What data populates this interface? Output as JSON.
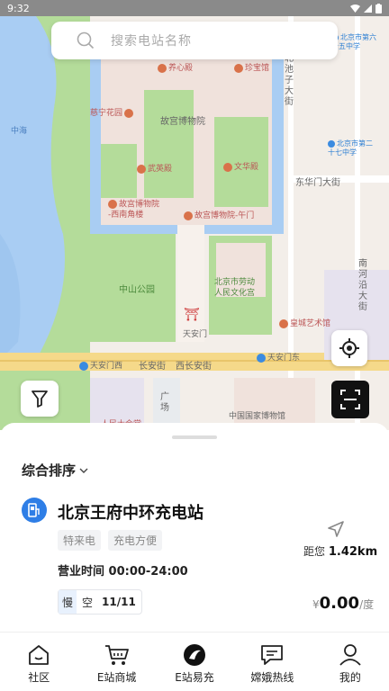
{
  "status": {
    "time": "9:32"
  },
  "search": {
    "placeholder": "搜索电站名称"
  },
  "map": {
    "labels": {
      "yangxin": "养心殿",
      "zhenbao": "珍宝馆",
      "cining": "慈宁花园",
      "museum": "故宫博物院",
      "wuying": "武英殿",
      "wenhua": "文华殿",
      "museum_sw": "故宫博物院\n-西南角楼",
      "museum_gate": "故宫博物院-午门",
      "zhongshan": "中山公园",
      "culture": "北京市劳动\n人民文化宫",
      "tiananmen": "天安门",
      "huangcheng": "皇城艺术馆",
      "tiananmen_w": "天安门西",
      "tiananmen_e": "天安门东",
      "changan": "西长安街",
      "changan_short": "长安街",
      "east_street": "东华门大街",
      "north_street": "北\n池\n子\n大\n街",
      "nanheyan": "南\n河\n沿\n大\n街",
      "school_1": "北京市第六\n十五中学",
      "school_2": "北京市第二\n十七中学",
      "zhonghai": "中海",
      "guangchang": "广\n场",
      "national_museum": "中国国家博物馆",
      "great_hall": "人民大会堂"
    }
  },
  "sheet": {
    "sort_label": "综合排序",
    "station": {
      "name": "北京王府中环充电站",
      "tags": [
        "特来电",
        "充电方便"
      ],
      "hours": "营业时间 00:00-24:00",
      "distance_prefix": "距您",
      "distance": "1.42km",
      "slot_type": "慢",
      "slot_state": "空",
      "slot_count": "11/11",
      "price_symbol": "¥",
      "price": "0.00",
      "price_unit": "/度"
    }
  },
  "tabs": [
    {
      "label": "社区",
      "icon": "home-icon"
    },
    {
      "label": "E站商城",
      "icon": "cart-icon"
    },
    {
      "label": "E站易充",
      "icon": "charge-logo-icon"
    },
    {
      "label": "嫦娥热线",
      "icon": "chat-icon"
    },
    {
      "label": "我的",
      "icon": "user-icon"
    }
  ],
  "colors": {
    "accent": "#2e7ee6",
    "water": "#a9cdf3",
    "park": "#b4dc9a"
  }
}
